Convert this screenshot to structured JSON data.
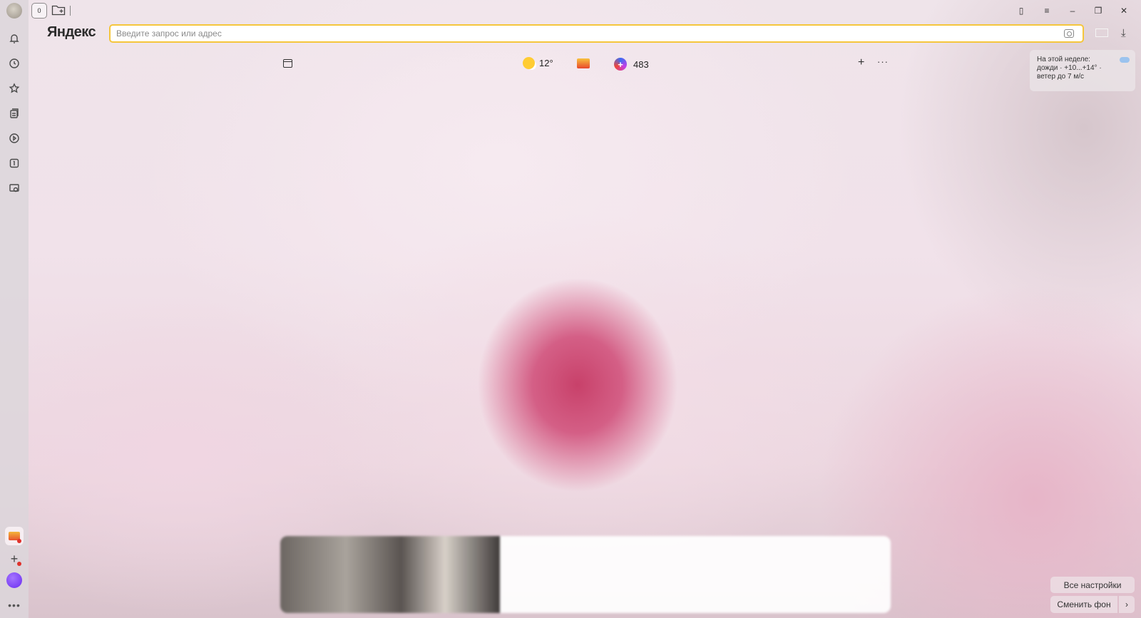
{
  "browser": {
    "logo": "Яндекс",
    "address": {
      "placeholder": "Введите запрос или адрес",
      "value": ""
    },
    "home_tab_label": "0"
  },
  "toolbar": {
    "weather_temp": "12°",
    "plus_points": "483"
  },
  "forecast": {
    "line1": "На этой неделе:",
    "line2": "дожди · +10...+14° ·",
    "line3": "ветер до 7 м/с"
  },
  "buttons": {
    "all_settings": "Все настройки",
    "change_background": "Сменить фон"
  },
  "sidebar": {
    "items": [
      "notifications-icon",
      "history-icon",
      "bookmarks-icon",
      "collections-icon",
      "video-icon",
      "tab-counter-icon",
      "screenshot-icon"
    ]
  },
  "colors": {
    "address_border": "#f5c63c",
    "accent_alice": "#6a2cf0"
  }
}
